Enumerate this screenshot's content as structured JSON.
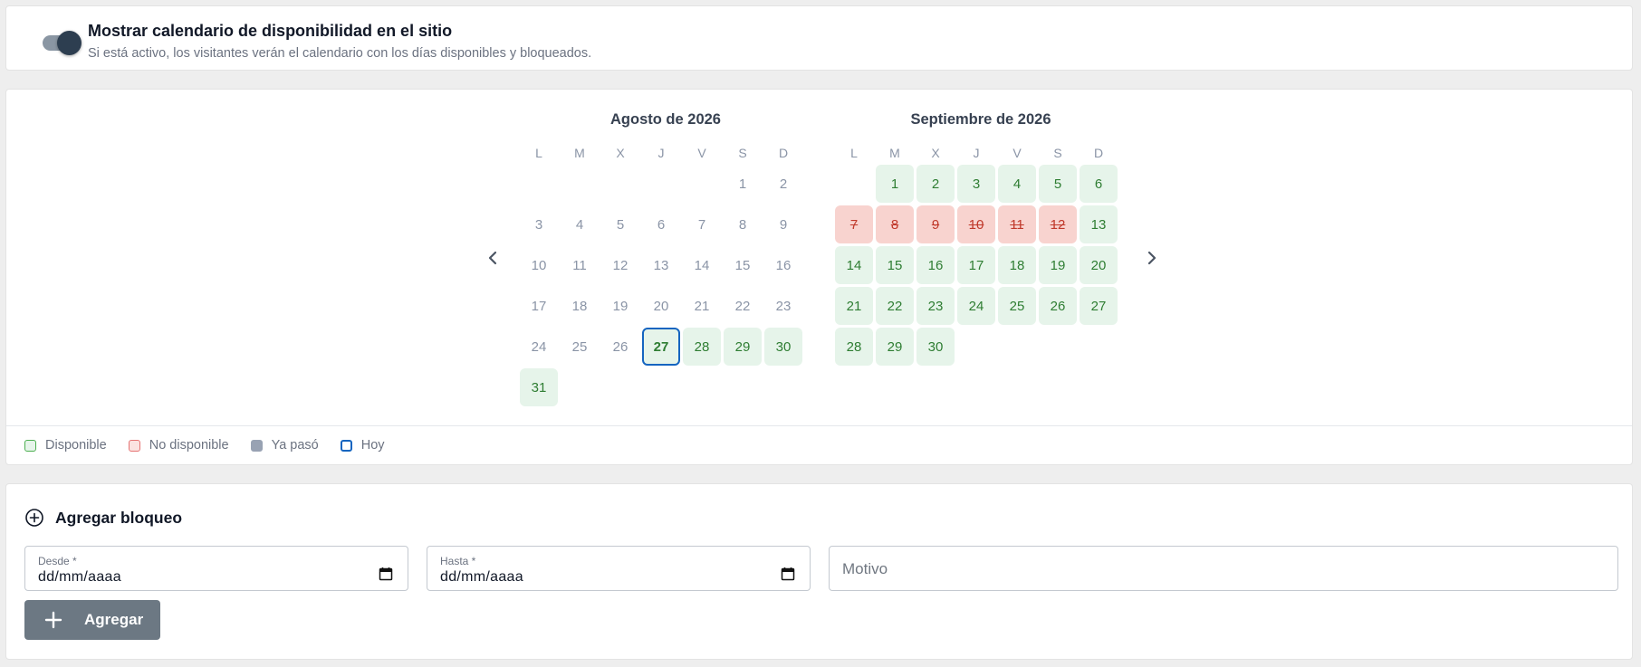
{
  "toggle": {
    "title": "Mostrar calendario de disponibilidad en el sitio",
    "description": "Si está activo, los visitantes verán el calendario con los días disponibles y bloqueados.",
    "enabled": true
  },
  "calendar": {
    "weekdays": [
      "L",
      "M",
      "X",
      "J",
      "V",
      "S",
      "D"
    ],
    "months": [
      {
        "title": "Agosto de 2026",
        "leading_blanks": 5,
        "days": [
          {
            "d": "1",
            "s": "past"
          },
          {
            "d": "2",
            "s": "past"
          },
          {
            "d": "3",
            "s": "past"
          },
          {
            "d": "4",
            "s": "past"
          },
          {
            "d": "5",
            "s": "past"
          },
          {
            "d": "6",
            "s": "past"
          },
          {
            "d": "7",
            "s": "past"
          },
          {
            "d": "8",
            "s": "past"
          },
          {
            "d": "9",
            "s": "past"
          },
          {
            "d": "10",
            "s": "past"
          },
          {
            "d": "11",
            "s": "past"
          },
          {
            "d": "12",
            "s": "past"
          },
          {
            "d": "13",
            "s": "past"
          },
          {
            "d": "14",
            "s": "past"
          },
          {
            "d": "15",
            "s": "past"
          },
          {
            "d": "16",
            "s": "past"
          },
          {
            "d": "17",
            "s": "past"
          },
          {
            "d": "18",
            "s": "past"
          },
          {
            "d": "19",
            "s": "past"
          },
          {
            "d": "20",
            "s": "past"
          },
          {
            "d": "21",
            "s": "past"
          },
          {
            "d": "22",
            "s": "past"
          },
          {
            "d": "23",
            "s": "past"
          },
          {
            "d": "24",
            "s": "past"
          },
          {
            "d": "25",
            "s": "past"
          },
          {
            "d": "26",
            "s": "past"
          },
          {
            "d": "27",
            "s": "today"
          },
          {
            "d": "28",
            "s": "available"
          },
          {
            "d": "29",
            "s": "available"
          },
          {
            "d": "30",
            "s": "available"
          },
          {
            "d": "31",
            "s": "available"
          }
        ]
      },
      {
        "title": "Septiembre de 2026",
        "leading_blanks": 1,
        "days": [
          {
            "d": "1",
            "s": "available"
          },
          {
            "d": "2",
            "s": "available"
          },
          {
            "d": "3",
            "s": "available"
          },
          {
            "d": "4",
            "s": "available"
          },
          {
            "d": "5",
            "s": "available"
          },
          {
            "d": "6",
            "s": "available"
          },
          {
            "d": "7",
            "s": "unavailable"
          },
          {
            "d": "8",
            "s": "unavailable"
          },
          {
            "d": "9",
            "s": "unavailable"
          },
          {
            "d": "10",
            "s": "unavailable"
          },
          {
            "d": "11",
            "s": "unavailable"
          },
          {
            "d": "12",
            "s": "unavailable"
          },
          {
            "d": "13",
            "s": "available"
          },
          {
            "d": "14",
            "s": "available"
          },
          {
            "d": "15",
            "s": "available"
          },
          {
            "d": "16",
            "s": "available"
          },
          {
            "d": "17",
            "s": "available"
          },
          {
            "d": "18",
            "s": "available"
          },
          {
            "d": "19",
            "s": "available"
          },
          {
            "d": "20",
            "s": "available"
          },
          {
            "d": "21",
            "s": "available"
          },
          {
            "d": "22",
            "s": "available"
          },
          {
            "d": "23",
            "s": "available"
          },
          {
            "d": "24",
            "s": "available"
          },
          {
            "d": "25",
            "s": "available"
          },
          {
            "d": "26",
            "s": "available"
          },
          {
            "d": "27",
            "s": "available"
          },
          {
            "d": "28",
            "s": "available"
          },
          {
            "d": "29",
            "s": "available"
          },
          {
            "d": "30",
            "s": "available"
          }
        ]
      }
    ],
    "prev_icon": "chevron-left-icon",
    "next_icon": "chevron-right-icon"
  },
  "legend": {
    "available": "Disponible",
    "unavailable": "No disponible",
    "past": "Ya pasó",
    "today": "Hoy"
  },
  "block_form": {
    "title": "Agregar bloqueo",
    "title_icon": "plus-circle-icon",
    "from_label": "Desde *",
    "from_value": "dd/mm/aaaa",
    "to_label": "Hasta *",
    "to_value": "dd/mm/aaaa",
    "reason_placeholder": "Motivo",
    "add_button_label": "Agregar",
    "add_button_icon": "plus-icon"
  },
  "colors": {
    "available_bg": "#e6f4ea",
    "available_text": "#2e7d32",
    "unavailable_bg": "#f8d3cf",
    "unavailable_text": "#c0392b",
    "today_border": "#1565c0",
    "button_bg": "#6c7883"
  }
}
